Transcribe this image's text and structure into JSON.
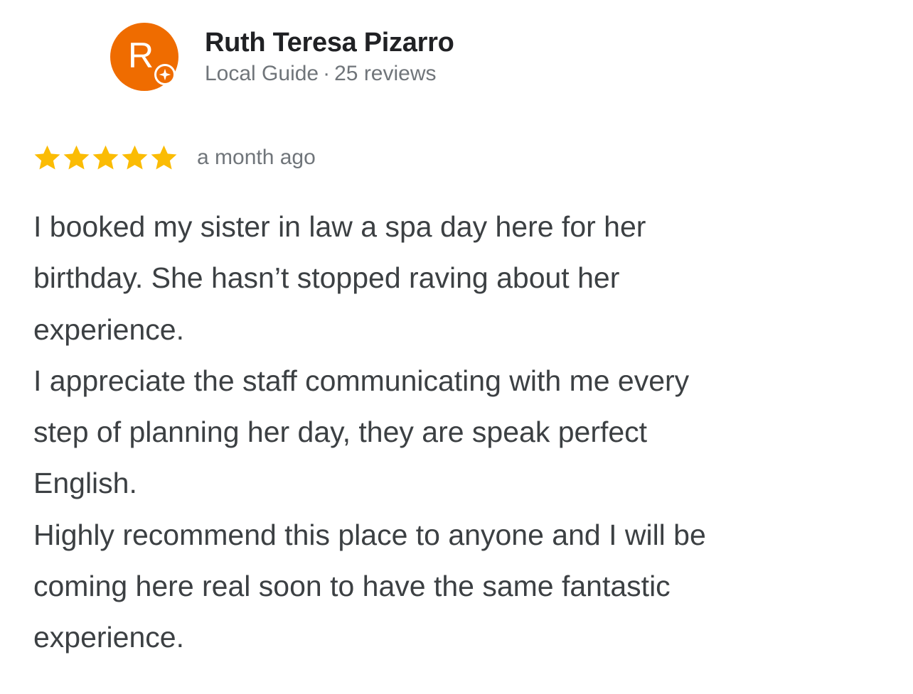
{
  "reviewer": {
    "avatar_letter": "R",
    "avatar_color": "#ef6c00",
    "name": "Ruth Teresa Pizarro",
    "badge": "Local Guide",
    "separator": "·",
    "review_count": "25 reviews",
    "badge_icon": "local-guide-star-icon"
  },
  "review": {
    "rating": 5,
    "max_rating": 5,
    "star_color": "#fbbc04",
    "time": "a month ago",
    "lines": [
      "I booked my sister in law a spa day here for her",
      "birthday. She hasn’t stopped raving about her",
      "experience.",
      "I appreciate the staff communicating with me every",
      "step of planning her day, they are speak perfect",
      "English.",
      "Highly recommend this place to anyone and I will be",
      "coming here real soon to have the same fantastic",
      "experience."
    ]
  }
}
